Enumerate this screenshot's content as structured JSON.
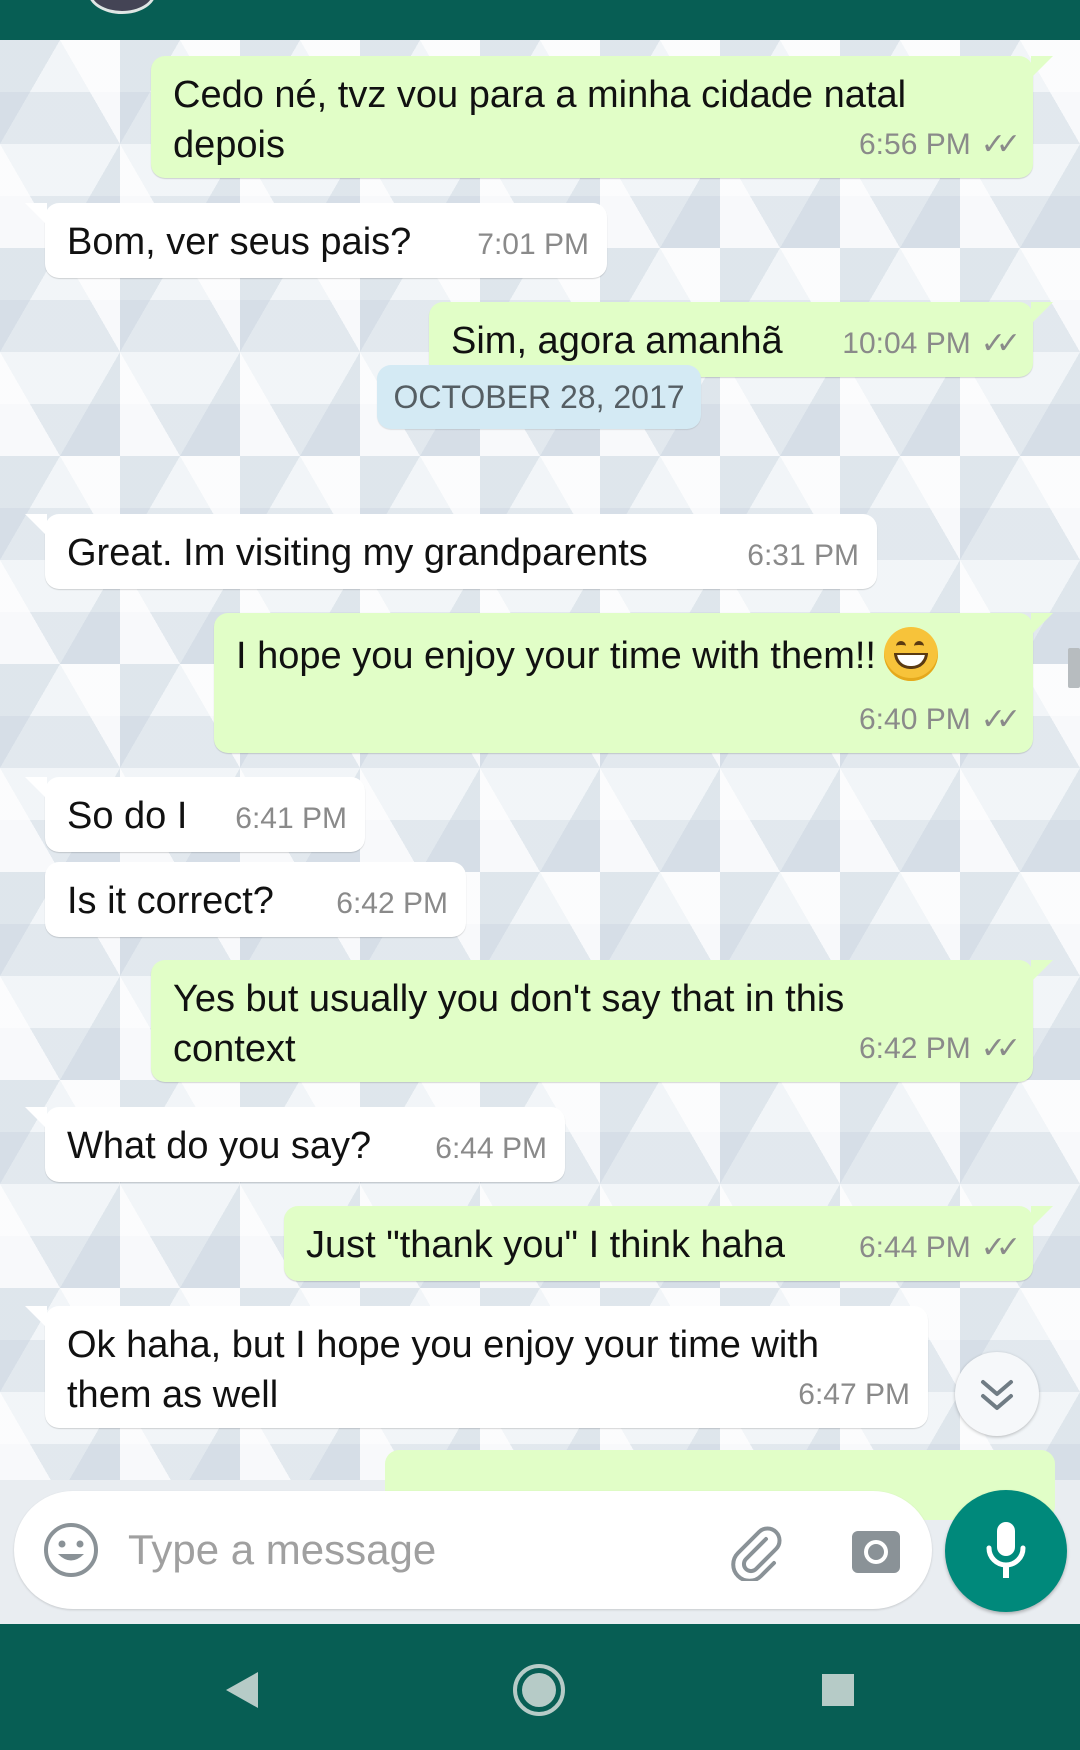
{
  "colors": {
    "header": "#075e54",
    "incoming_bubble": "#ffffff",
    "outgoing_bubble": "#e1fec7",
    "mic_button": "#00897b",
    "date_chip": "#d4eaf4"
  },
  "messages": [
    {
      "direction": "outgoing",
      "text": "Cedo né, tvz vou para a minha cidade natal\ndepois",
      "time": "6:56 PM",
      "status": "read-ticks"
    },
    {
      "direction": "incoming",
      "text": "Bom, ver seus pais?",
      "time": "7:01 PM"
    },
    {
      "direction": "outgoing",
      "text": "Sim, agora amanhã",
      "time": "10:04 PM",
      "status": "read-ticks"
    },
    {
      "direction": "incoming",
      "text": "Great. Im visiting my grandparents",
      "time": "6:31 PM"
    },
    {
      "direction": "outgoing",
      "text": "I hope you enjoy your time with them!!",
      "time": "6:40 PM",
      "status": "read-ticks",
      "emoji": "grinning-face-emoji"
    },
    {
      "direction": "incoming",
      "text": "So do I",
      "time": "6:41 PM"
    },
    {
      "direction": "incoming",
      "text": "Is it correct?",
      "time": "6:42 PM"
    },
    {
      "direction": "outgoing",
      "text": "Yes but usually you don't say that in this\ncontext",
      "time": "6:42 PM",
      "status": "read-ticks"
    },
    {
      "direction": "incoming",
      "text": "What do you say?",
      "time": "6:44 PM"
    },
    {
      "direction": "outgoing",
      "text": "Just \"thank you\" I think haha",
      "time": "6:44 PM",
      "status": "read-ticks"
    },
    {
      "direction": "incoming",
      "text": "Ok haha, but I hope you enjoy your time with\nthem as well",
      "time": "6:47 PM"
    }
  ],
  "date_divider": "OCTOBER 28, 2017",
  "ticks_glyph": "✓✓",
  "composer": {
    "placeholder": "Type a message",
    "icons": [
      "emoji-icon",
      "attach-icon",
      "camera-icon",
      "mic-icon"
    ]
  },
  "nav": {
    "icons": [
      "back-icon",
      "home-icon",
      "recents-icon"
    ]
  },
  "scroll_button_icon": "double-chevron-down-icon"
}
